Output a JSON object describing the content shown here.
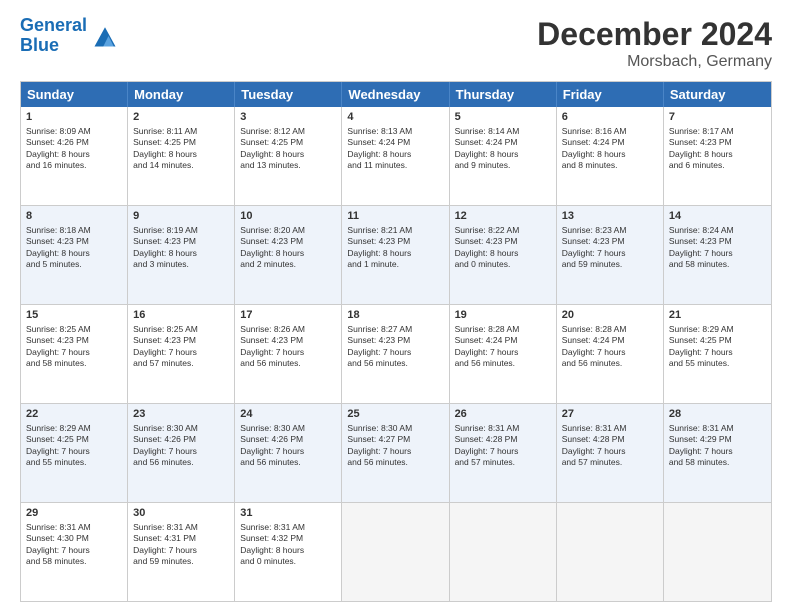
{
  "header": {
    "logo_line1": "General",
    "logo_line2": "Blue",
    "title": "December 2024",
    "subtitle": "Morsbach, Germany"
  },
  "days_of_week": [
    "Sunday",
    "Monday",
    "Tuesday",
    "Wednesday",
    "Thursday",
    "Friday",
    "Saturday"
  ],
  "weeks": [
    [
      {
        "day": "1",
        "lines": [
          "Sunrise: 8:09 AM",
          "Sunset: 4:26 PM",
          "Daylight: 8 hours",
          "and 16 minutes."
        ]
      },
      {
        "day": "2",
        "lines": [
          "Sunrise: 8:11 AM",
          "Sunset: 4:25 PM",
          "Daylight: 8 hours",
          "and 14 minutes."
        ]
      },
      {
        "day": "3",
        "lines": [
          "Sunrise: 8:12 AM",
          "Sunset: 4:25 PM",
          "Daylight: 8 hours",
          "and 13 minutes."
        ]
      },
      {
        "day": "4",
        "lines": [
          "Sunrise: 8:13 AM",
          "Sunset: 4:24 PM",
          "Daylight: 8 hours",
          "and 11 minutes."
        ]
      },
      {
        "day": "5",
        "lines": [
          "Sunrise: 8:14 AM",
          "Sunset: 4:24 PM",
          "Daylight: 8 hours",
          "and 9 minutes."
        ]
      },
      {
        "day": "6",
        "lines": [
          "Sunrise: 8:16 AM",
          "Sunset: 4:24 PM",
          "Daylight: 8 hours",
          "and 8 minutes."
        ]
      },
      {
        "day": "7",
        "lines": [
          "Sunrise: 8:17 AM",
          "Sunset: 4:23 PM",
          "Daylight: 8 hours",
          "and 6 minutes."
        ]
      }
    ],
    [
      {
        "day": "8",
        "lines": [
          "Sunrise: 8:18 AM",
          "Sunset: 4:23 PM",
          "Daylight: 8 hours",
          "and 5 minutes."
        ]
      },
      {
        "day": "9",
        "lines": [
          "Sunrise: 8:19 AM",
          "Sunset: 4:23 PM",
          "Daylight: 8 hours",
          "and 3 minutes."
        ]
      },
      {
        "day": "10",
        "lines": [
          "Sunrise: 8:20 AM",
          "Sunset: 4:23 PM",
          "Daylight: 8 hours",
          "and 2 minutes."
        ]
      },
      {
        "day": "11",
        "lines": [
          "Sunrise: 8:21 AM",
          "Sunset: 4:23 PM",
          "Daylight: 8 hours",
          "and 1 minute."
        ]
      },
      {
        "day": "12",
        "lines": [
          "Sunrise: 8:22 AM",
          "Sunset: 4:23 PM",
          "Daylight: 8 hours",
          "and 0 minutes."
        ]
      },
      {
        "day": "13",
        "lines": [
          "Sunrise: 8:23 AM",
          "Sunset: 4:23 PM",
          "Daylight: 7 hours",
          "and 59 minutes."
        ]
      },
      {
        "day": "14",
        "lines": [
          "Sunrise: 8:24 AM",
          "Sunset: 4:23 PM",
          "Daylight: 7 hours",
          "and 58 minutes."
        ]
      }
    ],
    [
      {
        "day": "15",
        "lines": [
          "Sunrise: 8:25 AM",
          "Sunset: 4:23 PM",
          "Daylight: 7 hours",
          "and 58 minutes."
        ]
      },
      {
        "day": "16",
        "lines": [
          "Sunrise: 8:25 AM",
          "Sunset: 4:23 PM",
          "Daylight: 7 hours",
          "and 57 minutes."
        ]
      },
      {
        "day": "17",
        "lines": [
          "Sunrise: 8:26 AM",
          "Sunset: 4:23 PM",
          "Daylight: 7 hours",
          "and 56 minutes."
        ]
      },
      {
        "day": "18",
        "lines": [
          "Sunrise: 8:27 AM",
          "Sunset: 4:23 PM",
          "Daylight: 7 hours",
          "and 56 minutes."
        ]
      },
      {
        "day": "19",
        "lines": [
          "Sunrise: 8:28 AM",
          "Sunset: 4:24 PM",
          "Daylight: 7 hours",
          "and 56 minutes."
        ]
      },
      {
        "day": "20",
        "lines": [
          "Sunrise: 8:28 AM",
          "Sunset: 4:24 PM",
          "Daylight: 7 hours",
          "and 56 minutes."
        ]
      },
      {
        "day": "21",
        "lines": [
          "Sunrise: 8:29 AM",
          "Sunset: 4:25 PM",
          "Daylight: 7 hours",
          "and 55 minutes."
        ]
      }
    ],
    [
      {
        "day": "22",
        "lines": [
          "Sunrise: 8:29 AM",
          "Sunset: 4:25 PM",
          "Daylight: 7 hours",
          "and 55 minutes."
        ]
      },
      {
        "day": "23",
        "lines": [
          "Sunrise: 8:30 AM",
          "Sunset: 4:26 PM",
          "Daylight: 7 hours",
          "and 56 minutes."
        ]
      },
      {
        "day": "24",
        "lines": [
          "Sunrise: 8:30 AM",
          "Sunset: 4:26 PM",
          "Daylight: 7 hours",
          "and 56 minutes."
        ]
      },
      {
        "day": "25",
        "lines": [
          "Sunrise: 8:30 AM",
          "Sunset: 4:27 PM",
          "Daylight: 7 hours",
          "and 56 minutes."
        ]
      },
      {
        "day": "26",
        "lines": [
          "Sunrise: 8:31 AM",
          "Sunset: 4:28 PM",
          "Daylight: 7 hours",
          "and 57 minutes."
        ]
      },
      {
        "day": "27",
        "lines": [
          "Sunrise: 8:31 AM",
          "Sunset: 4:28 PM",
          "Daylight: 7 hours",
          "and 57 minutes."
        ]
      },
      {
        "day": "28",
        "lines": [
          "Sunrise: 8:31 AM",
          "Sunset: 4:29 PM",
          "Daylight: 7 hours",
          "and 58 minutes."
        ]
      }
    ],
    [
      {
        "day": "29",
        "lines": [
          "Sunrise: 8:31 AM",
          "Sunset: 4:30 PM",
          "Daylight: 7 hours",
          "and 58 minutes."
        ]
      },
      {
        "day": "30",
        "lines": [
          "Sunrise: 8:31 AM",
          "Sunset: 4:31 PM",
          "Daylight: 7 hours",
          "and 59 minutes."
        ]
      },
      {
        "day": "31",
        "lines": [
          "Sunrise: 8:31 AM",
          "Sunset: 4:32 PM",
          "Daylight: 8 hours",
          "and 0 minutes."
        ]
      },
      {
        "day": "",
        "lines": []
      },
      {
        "day": "",
        "lines": []
      },
      {
        "day": "",
        "lines": []
      },
      {
        "day": "",
        "lines": []
      }
    ]
  ]
}
